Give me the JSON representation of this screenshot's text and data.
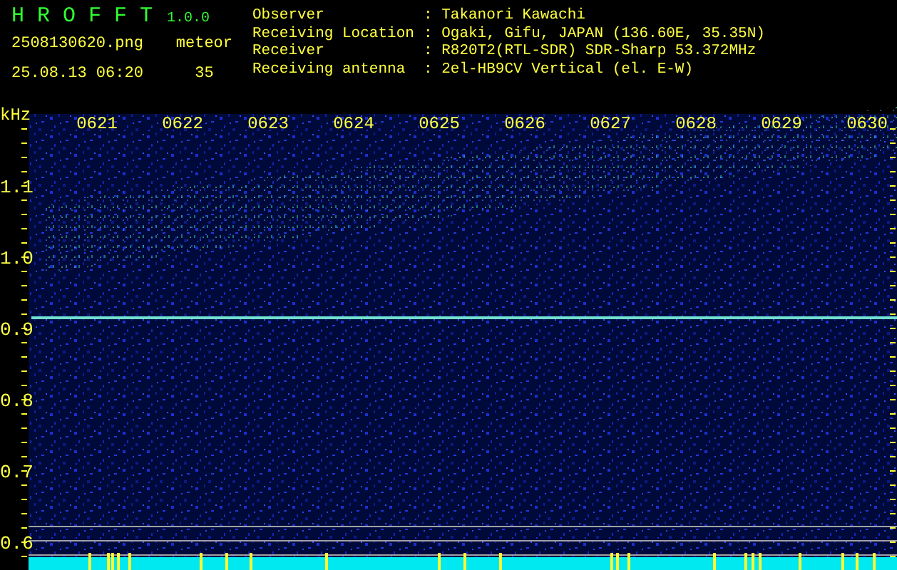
{
  "app": {
    "name": "H R O F F T",
    "version": "1.0.0"
  },
  "file": {
    "name": "2508130620.png",
    "datetime": "25.08.13 06:20"
  },
  "count": {
    "label": "meteor",
    "value": "35"
  },
  "info": [
    {
      "label": "Observer",
      "value": ": Takanori Kawachi"
    },
    {
      "label": "Receiving Location",
      "value": ": Ogaki, Gifu, JAPAN (136.60E, 35.35N)"
    },
    {
      "label": "Receiver",
      "value": ": R820T2(RTL-SDR) SDR-Sharp 53.372MHz"
    },
    {
      "label": "Receiving antenna",
      "value": ": 2el-HB9CV Vertical (el. E-W)"
    }
  ],
  "plot": {
    "unit": "kHz",
    "yticks": [
      "1.1",
      "1.0",
      "0.9",
      "0.8",
      "0.7",
      "0.6"
    ],
    "time_labels": [
      "0621",
      "0622",
      "0623",
      "0624",
      "0625",
      "0626",
      "0627",
      "0628",
      "0629",
      "0630"
    ]
  }
}
